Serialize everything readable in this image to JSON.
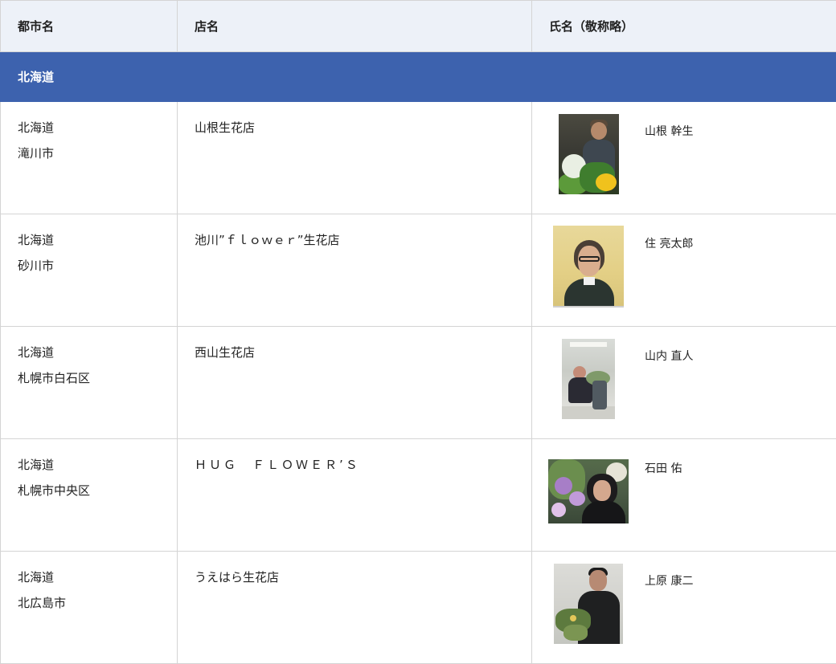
{
  "table": {
    "headers": {
      "city": "都市名",
      "shop": "店名",
      "person": "氏名（敬称略）"
    },
    "region": "北海道",
    "rows": [
      {
        "prefecture": "北海道",
        "city": "滝川市",
        "shop": "山根生花店",
        "person": "山根 幹生",
        "photo_icon": "florist-photo"
      },
      {
        "prefecture": "北海道",
        "city": "砂川市",
        "shop": "池川”ｆｌｏｗｅｒ”生花店",
        "person": "住 亮太郎",
        "photo_icon": "florist-photo"
      },
      {
        "prefecture": "北海道",
        "city": "札幌市白石区",
        "shop": "西山生花店",
        "person": "山内 直人",
        "photo_icon": "florist-photo"
      },
      {
        "prefecture": "北海道",
        "city": "札幌市中央区",
        "shop": "ＨＵＧ　ＦＬＯＷＥＲ’Ｓ",
        "person": "石田 佑",
        "photo_icon": "florist-photo"
      },
      {
        "prefecture": "北海道",
        "city": "北広島市",
        "shop": "うえはら生花店",
        "person": "上原 康二",
        "photo_icon": "florist-photo"
      }
    ]
  },
  "colors": {
    "header_bg": "#edf1f8",
    "region_bg": "#3d62ae",
    "border": "#d4d4d4"
  }
}
